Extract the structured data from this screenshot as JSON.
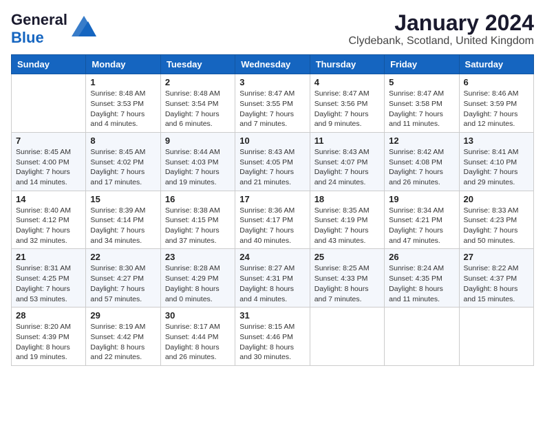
{
  "header": {
    "logo_line1": "General",
    "logo_line2": "Blue",
    "month_title": "January 2024",
    "location": "Clydebank, Scotland, United Kingdom"
  },
  "weekdays": [
    "Sunday",
    "Monday",
    "Tuesday",
    "Wednesday",
    "Thursday",
    "Friday",
    "Saturday"
  ],
  "weeks": [
    [
      {
        "day": "",
        "info": ""
      },
      {
        "day": "1",
        "info": "Sunrise: 8:48 AM\nSunset: 3:53 PM\nDaylight: 7 hours\nand 4 minutes."
      },
      {
        "day": "2",
        "info": "Sunrise: 8:48 AM\nSunset: 3:54 PM\nDaylight: 7 hours\nand 6 minutes."
      },
      {
        "day": "3",
        "info": "Sunrise: 8:47 AM\nSunset: 3:55 PM\nDaylight: 7 hours\nand 7 minutes."
      },
      {
        "day": "4",
        "info": "Sunrise: 8:47 AM\nSunset: 3:56 PM\nDaylight: 7 hours\nand 9 minutes."
      },
      {
        "day": "5",
        "info": "Sunrise: 8:47 AM\nSunset: 3:58 PM\nDaylight: 7 hours\nand 11 minutes."
      },
      {
        "day": "6",
        "info": "Sunrise: 8:46 AM\nSunset: 3:59 PM\nDaylight: 7 hours\nand 12 minutes."
      }
    ],
    [
      {
        "day": "7",
        "info": "Sunrise: 8:45 AM\nSunset: 4:00 PM\nDaylight: 7 hours\nand 14 minutes."
      },
      {
        "day": "8",
        "info": "Sunrise: 8:45 AM\nSunset: 4:02 PM\nDaylight: 7 hours\nand 17 minutes."
      },
      {
        "day": "9",
        "info": "Sunrise: 8:44 AM\nSunset: 4:03 PM\nDaylight: 7 hours\nand 19 minutes."
      },
      {
        "day": "10",
        "info": "Sunrise: 8:43 AM\nSunset: 4:05 PM\nDaylight: 7 hours\nand 21 minutes."
      },
      {
        "day": "11",
        "info": "Sunrise: 8:43 AM\nSunset: 4:07 PM\nDaylight: 7 hours\nand 24 minutes."
      },
      {
        "day": "12",
        "info": "Sunrise: 8:42 AM\nSunset: 4:08 PM\nDaylight: 7 hours\nand 26 minutes."
      },
      {
        "day": "13",
        "info": "Sunrise: 8:41 AM\nSunset: 4:10 PM\nDaylight: 7 hours\nand 29 minutes."
      }
    ],
    [
      {
        "day": "14",
        "info": "Sunrise: 8:40 AM\nSunset: 4:12 PM\nDaylight: 7 hours\nand 32 minutes."
      },
      {
        "day": "15",
        "info": "Sunrise: 8:39 AM\nSunset: 4:14 PM\nDaylight: 7 hours\nand 34 minutes."
      },
      {
        "day": "16",
        "info": "Sunrise: 8:38 AM\nSunset: 4:15 PM\nDaylight: 7 hours\nand 37 minutes."
      },
      {
        "day": "17",
        "info": "Sunrise: 8:36 AM\nSunset: 4:17 PM\nDaylight: 7 hours\nand 40 minutes."
      },
      {
        "day": "18",
        "info": "Sunrise: 8:35 AM\nSunset: 4:19 PM\nDaylight: 7 hours\nand 43 minutes."
      },
      {
        "day": "19",
        "info": "Sunrise: 8:34 AM\nSunset: 4:21 PM\nDaylight: 7 hours\nand 47 minutes."
      },
      {
        "day": "20",
        "info": "Sunrise: 8:33 AM\nSunset: 4:23 PM\nDaylight: 7 hours\nand 50 minutes."
      }
    ],
    [
      {
        "day": "21",
        "info": "Sunrise: 8:31 AM\nSunset: 4:25 PM\nDaylight: 7 hours\nand 53 minutes."
      },
      {
        "day": "22",
        "info": "Sunrise: 8:30 AM\nSunset: 4:27 PM\nDaylight: 7 hours\nand 57 minutes."
      },
      {
        "day": "23",
        "info": "Sunrise: 8:28 AM\nSunset: 4:29 PM\nDaylight: 8 hours\nand 0 minutes."
      },
      {
        "day": "24",
        "info": "Sunrise: 8:27 AM\nSunset: 4:31 PM\nDaylight: 8 hours\nand 4 minutes."
      },
      {
        "day": "25",
        "info": "Sunrise: 8:25 AM\nSunset: 4:33 PM\nDaylight: 8 hours\nand 7 minutes."
      },
      {
        "day": "26",
        "info": "Sunrise: 8:24 AM\nSunset: 4:35 PM\nDaylight: 8 hours\nand 11 minutes."
      },
      {
        "day": "27",
        "info": "Sunrise: 8:22 AM\nSunset: 4:37 PM\nDaylight: 8 hours\nand 15 minutes."
      }
    ],
    [
      {
        "day": "28",
        "info": "Sunrise: 8:20 AM\nSunset: 4:39 PM\nDaylight: 8 hours\nand 19 minutes."
      },
      {
        "day": "29",
        "info": "Sunrise: 8:19 AM\nSunset: 4:42 PM\nDaylight: 8 hours\nand 22 minutes."
      },
      {
        "day": "30",
        "info": "Sunrise: 8:17 AM\nSunset: 4:44 PM\nDaylight: 8 hours\nand 26 minutes."
      },
      {
        "day": "31",
        "info": "Sunrise: 8:15 AM\nSunset: 4:46 PM\nDaylight: 8 hours\nand 30 minutes."
      },
      {
        "day": "",
        "info": ""
      },
      {
        "day": "",
        "info": ""
      },
      {
        "day": "",
        "info": ""
      }
    ]
  ]
}
